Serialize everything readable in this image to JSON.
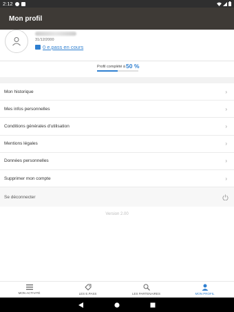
{
  "status_bar": {
    "time": "2:12"
  },
  "app_bar": {
    "title": "Mon profil"
  },
  "profile": {
    "birth_date": "31/12/2000",
    "epass_link": "0 e.pass en cours"
  },
  "completion": {
    "label": "Profil complété à",
    "percent_text": "50 %",
    "percent_value": 50
  },
  "menu": {
    "items": [
      {
        "label": "Mon historique"
      },
      {
        "label": "Mes infos personnelles"
      },
      {
        "label": "Conditions générales d'utilisation"
      },
      {
        "label": "Mentions légales"
      },
      {
        "label": "Données personnelles"
      },
      {
        "label": "Supprimer mon compte"
      }
    ]
  },
  "logout": {
    "label": "Se déconnecter"
  },
  "version": "Version 2.00",
  "bottom_nav": {
    "items": [
      {
        "label": "MON ACTIVITÉ",
        "icon": "menu-icon"
      },
      {
        "label": "LES E.PASS",
        "icon": "epass-icon"
      },
      {
        "label": "LES PARTENAIRES",
        "icon": "search-icon"
      },
      {
        "label": "MON PROFIL",
        "icon": "person-icon",
        "active": true
      }
    ]
  },
  "colors": {
    "accent": "#2e7fd0",
    "appbar": "#3e3a36"
  }
}
